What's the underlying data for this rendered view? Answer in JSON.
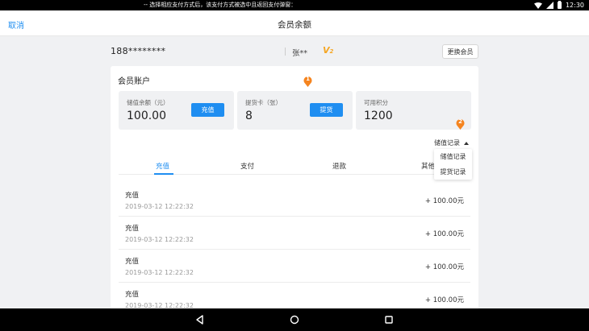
{
  "status_bar": {
    "notice": "-- 选择相应支付方式后，该支付方式被选中且返回支付弹窗：",
    "time": "12:30",
    "icons": [
      "wifi-icon",
      "signal-icon",
      "battery-icon"
    ]
  },
  "header": {
    "cancel_label": "取消",
    "title": "会员余额"
  },
  "member": {
    "phone": "188********",
    "name": "张**",
    "vip_prefix": "V",
    "vip_level": "2",
    "switch_label": "更换会员"
  },
  "account": {
    "heading": "会员账户",
    "stats": [
      {
        "label": "储值余额（元）",
        "value": "100.00",
        "button": "充值"
      },
      {
        "label": "提货卡（张）",
        "value": "8",
        "button": "提货"
      },
      {
        "label": "可用积分",
        "value": "1200"
      }
    ],
    "markers": [
      "1",
      "2"
    ],
    "records_toggle": "储值记录",
    "dropdown_options": [
      "储值记录",
      "提货记录"
    ],
    "tabs": [
      "充值",
      "支付",
      "退款",
      "其他"
    ],
    "active_tab": "充值",
    "rows": [
      {
        "title": "充值",
        "time": "2019-03-12 12:22:32",
        "amount": "+ 100.00元"
      },
      {
        "title": "充值",
        "time": "2019-03-12 12:22:32",
        "amount": "+ 100.00元"
      },
      {
        "title": "充值",
        "time": "2019-03-12 12:22:32",
        "amount": "+ 100.00元"
      },
      {
        "title": "充值",
        "time": "2019-03-12 12:22:32",
        "amount": "+ 100.00元"
      }
    ]
  },
  "colors": {
    "accent": "#1f8ef1",
    "marker": "#f5841f",
    "vip": "#f5a623"
  },
  "nav_icons": [
    "back-icon",
    "home-icon",
    "recents-icon"
  ]
}
